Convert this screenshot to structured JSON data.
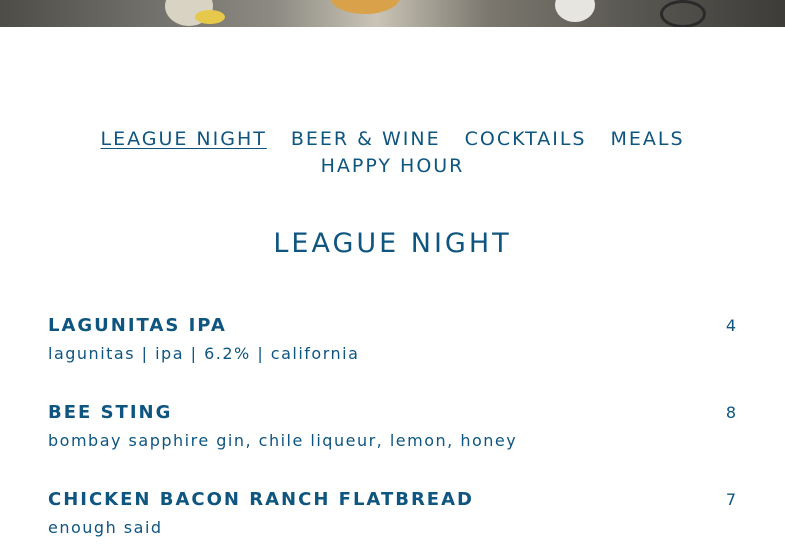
{
  "nav": {
    "rows": [
      [
        "LEAGUE NIGHT",
        "BEER & WINE",
        "COCKTAILS",
        "MEALS"
      ],
      [
        "HAPPY HOUR"
      ]
    ],
    "active": "LEAGUE NIGHT"
  },
  "section": {
    "title": "LEAGUE NIGHT"
  },
  "items": [
    {
      "name": "LAGUNITAS IPA",
      "description": "lagunitas | ipa | 6.2% | california",
      "price": "4"
    },
    {
      "name": "BEE STING",
      "description": "bombay sapphire gin, chile liqueur, lemon, honey",
      "price": "8"
    },
    {
      "name": "CHICKEN BACON RANCH FLATBREAD",
      "description": "enough said",
      "price": "7"
    }
  ],
  "colors": {
    "text": "#0e5580",
    "background": "#ffffff"
  }
}
